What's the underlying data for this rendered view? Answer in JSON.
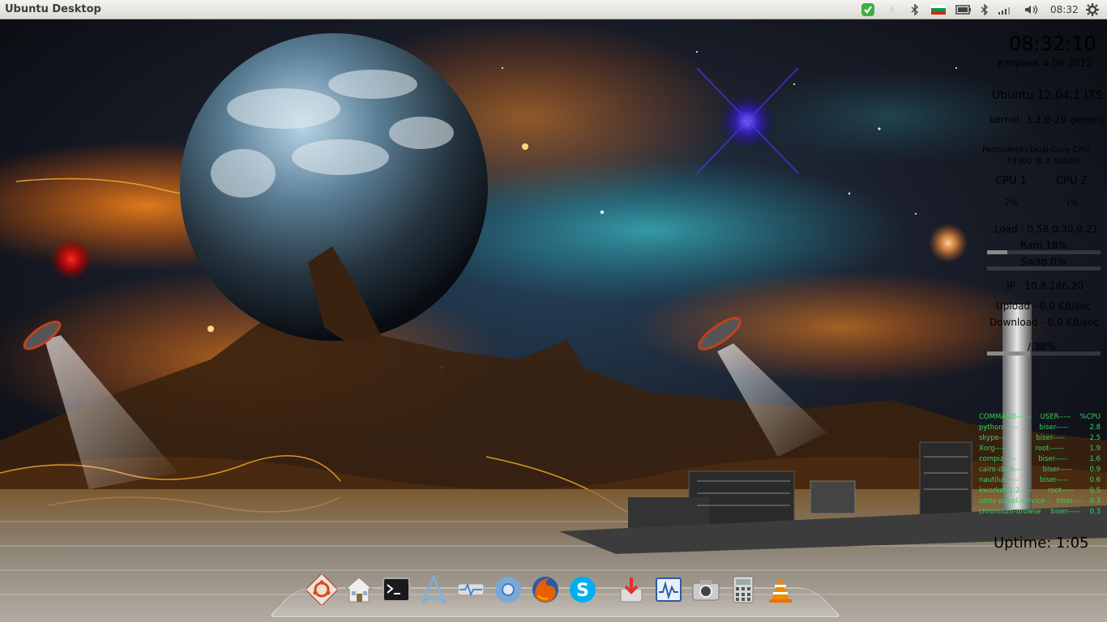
{
  "panel": {
    "title": "Ubuntu Desktop",
    "clock": "08:32",
    "tray_icons": [
      "checkmark-icon",
      "bluetooth-icon",
      "keyboard-layout-flag-icon",
      "battery-icon",
      "bluetooth-icon",
      "network-signal-icon",
      "volume-icon",
      "power-gear-icon"
    ]
  },
  "conky": {
    "time": "08:32:10",
    "date": "вторник  4.09.2012",
    "os": "Ubuntu 12.04.1 LTS",
    "kernel": "kernel: 3.2.0-29-generic",
    "cpu_model_1": "Pentium(R) Dual-Core CPU",
    "cpu_model_2": "T4300  @ 2.10GHz",
    "cpu1_label": "CPU 1",
    "cpu2_label": "CPU 2",
    "cpu1_value": "2%",
    "cpu2_value": "1%",
    "load": "Load : 0.58,0.30,0.21",
    "ram": "Ram 18%",
    "ram_fraction": 0.18,
    "swap": "Swap 0%",
    "swap_fraction": 0.0,
    "ip": "IP : 10.8.186.20",
    "upload": "Upload - 0.0 KB/sec",
    "download": "Download - 0.0 KB/sec",
    "disk": "/ 38%",
    "disk_fraction": 0.38,
    "uptime": "Uptime: 1:05",
    "proc_header": {
      "command": "COMMAND------",
      "user": "USER-----",
      "cpu": "%CPU"
    },
    "processes": [
      {
        "command": "python------",
        "user": "biser-----",
        "cpu": "2.8"
      },
      {
        "command": "skype-----",
        "user": "biser-----",
        "cpu": "2.5"
      },
      {
        "command": "Xorg------",
        "user": "root------",
        "cpu": "1.9"
      },
      {
        "command": "compiz-----",
        "user": "biser-----",
        "cpu": "1.6"
      },
      {
        "command": "cairo-dock----",
        "user": "biser-----",
        "cpu": "0.9"
      },
      {
        "command": "nautilus-----",
        "user": "biser-----",
        "cpu": "0.6"
      },
      {
        "command": "kworker/1:2-----",
        "user": "root-----",
        "cpu": "0.5"
      },
      {
        "command": "unity-panel-service--",
        "user": "biser----",
        "cpu": "0.3"
      },
      {
        "command": "chromium-browse",
        "user": "biser-----",
        "cpu": "0.3"
      }
    ]
  },
  "dock": {
    "items": [
      "ubuntu-software-center-icon",
      "home-folder-icon",
      "terminal-icon",
      "arch-launcher-icon",
      "network-monitor-icon",
      "chromium-icon",
      "firefox-icon",
      "skype-icon",
      "update-manager-icon",
      "system-monitor-icon",
      "screenshot-camera-icon",
      "calculator-icon",
      "vlc-icon"
    ]
  }
}
